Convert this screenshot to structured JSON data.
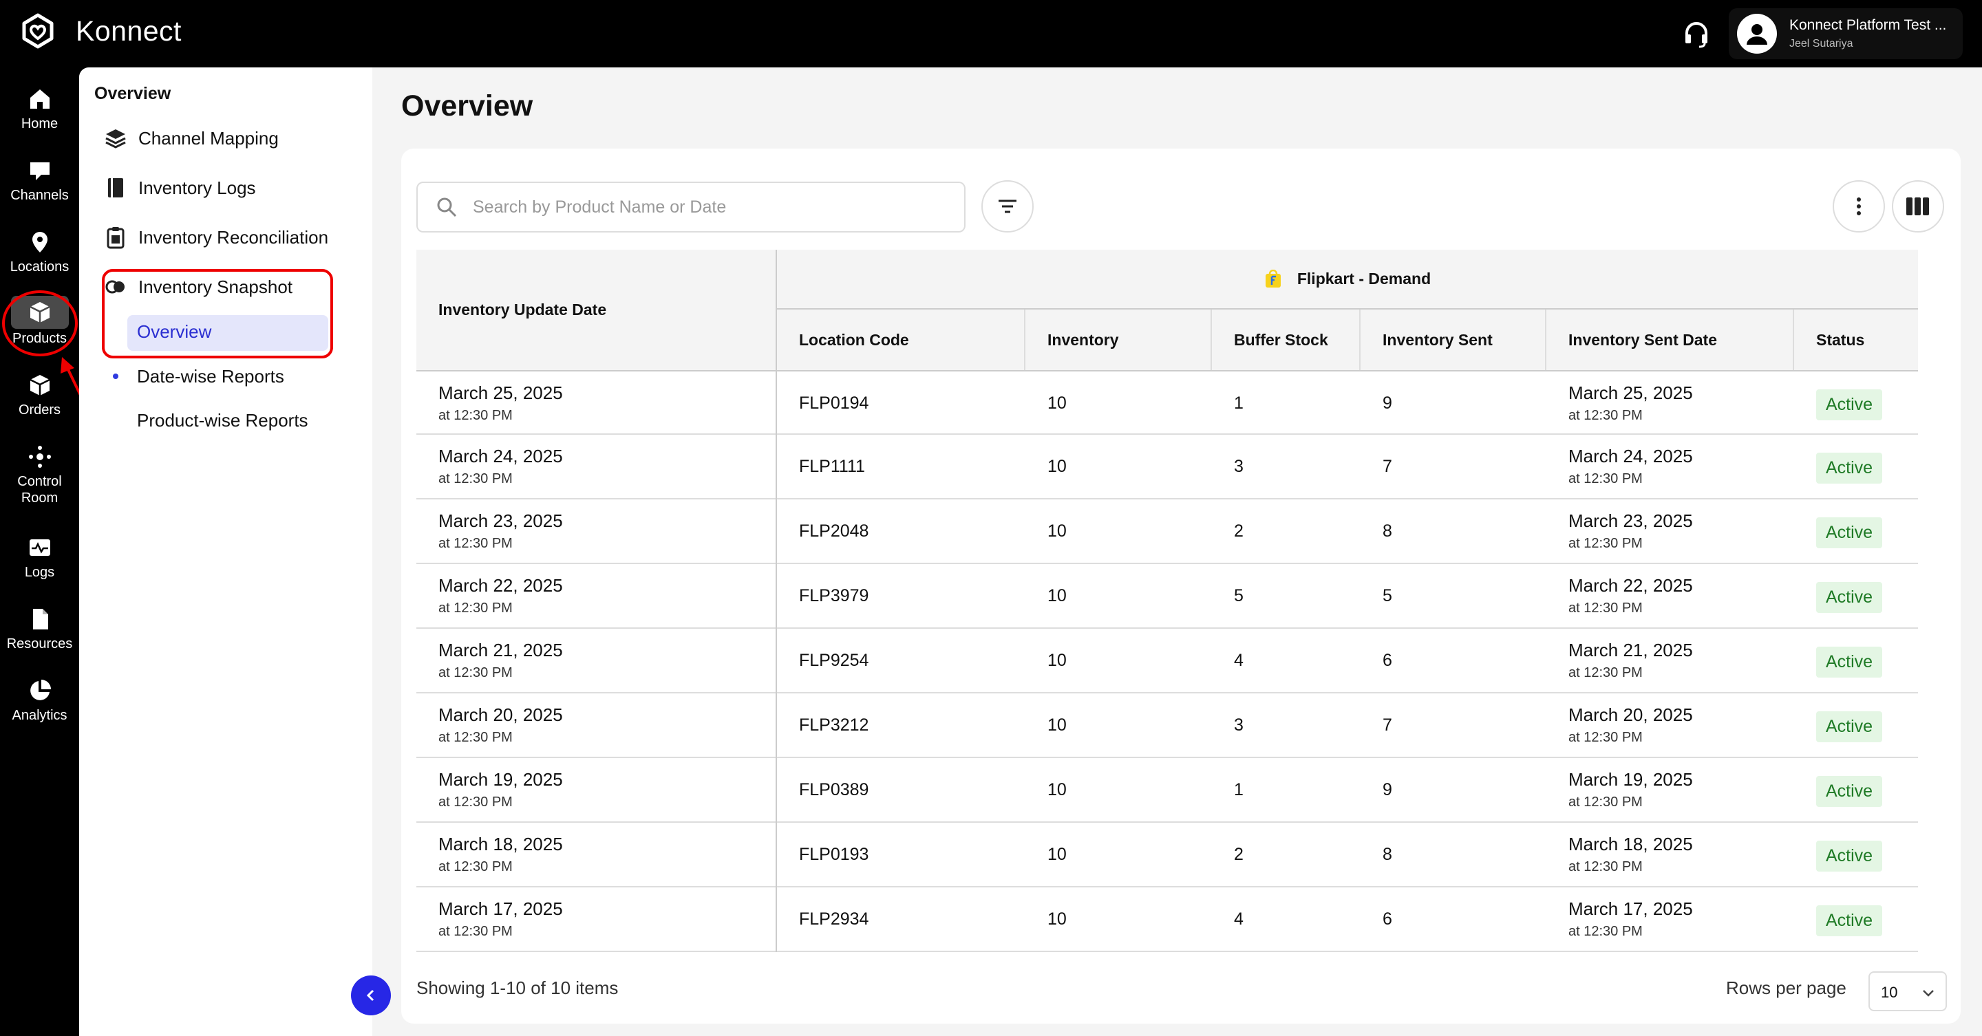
{
  "app": {
    "name": "Konnect"
  },
  "user": {
    "name": "Konnect Platform Test ...",
    "subtitle": "Jeel Sutariya"
  },
  "rail": [
    {
      "label": "Home",
      "icon": "home-icon"
    },
    {
      "label": "Channels",
      "icon": "channels-icon"
    },
    {
      "label": "Locations",
      "icon": "location-pin-icon"
    },
    {
      "label": "Products",
      "icon": "box-icon",
      "active": true
    },
    {
      "label": "Orders",
      "icon": "orders-icon"
    },
    {
      "label": "Control Room",
      "icon": "control-room-icon"
    },
    {
      "label": "Logs",
      "icon": "logs-icon"
    },
    {
      "label": "Resources",
      "icon": "file-icon"
    },
    {
      "label": "Analytics",
      "icon": "pie-chart-icon"
    }
  ],
  "subnav": {
    "title": "Overview",
    "items": [
      {
        "label": "Channel Mapping",
        "icon": "layers-icon"
      },
      {
        "label": "Inventory Logs",
        "icon": "book-icon"
      },
      {
        "label": "Inventory Reconciliation",
        "icon": "clipboard-icon"
      },
      {
        "label": "Inventory Snapshot",
        "icon": "toggle-icon"
      }
    ],
    "children": [
      {
        "label": "Overview",
        "active": true
      },
      {
        "label": "Date-wise Reports"
      },
      {
        "label": "Product-wise Reports"
      }
    ]
  },
  "main": {
    "title": "Overview",
    "search_placeholder": "Search by Product Name or Date",
    "group_header": "Flipkart - Demand",
    "columns": {
      "date": "Inventory Update Date",
      "location": "Location Code",
      "inventory": "Inventory",
      "buffer": "Buffer Stock",
      "sent": "Inventory Sent",
      "sent_date": "Inventory Sent Date",
      "status": "Status"
    },
    "rows": [
      {
        "date": "March 25, 2025",
        "time": "at 12:30 PM",
        "location": "FLP0194",
        "inventory": "10",
        "buffer": "1",
        "sent": "9",
        "sent_date": "March 25, 2025",
        "sent_time": "at 12:30 PM",
        "status": "Active"
      },
      {
        "date": "March 24, 2025",
        "time": "at 12:30 PM",
        "location": "FLP1111",
        "inventory": "10",
        "buffer": "3",
        "sent": "7",
        "sent_date": "March 24, 2025",
        "sent_time": "at 12:30 PM",
        "status": "Active"
      },
      {
        "date": "March 23, 2025",
        "time": "at 12:30 PM",
        "location": "FLP2048",
        "inventory": "10",
        "buffer": "2",
        "sent": "8",
        "sent_date": "March 23, 2025",
        "sent_time": "at 12:30 PM",
        "status": "Active"
      },
      {
        "date": "March 22, 2025",
        "time": "at 12:30 PM",
        "location": "FLP3979",
        "inventory": "10",
        "buffer": "5",
        "sent": "5",
        "sent_date": "March 22, 2025",
        "sent_time": "at 12:30 PM",
        "status": "Active"
      },
      {
        "date": "March 21, 2025",
        "time": "at 12:30 PM",
        "location": "FLP9254",
        "inventory": "10",
        "buffer": "4",
        "sent": "6",
        "sent_date": "March 21, 2025",
        "sent_time": "at 12:30 PM",
        "status": "Active"
      },
      {
        "date": "March 20, 2025",
        "time": "at 12:30 PM",
        "location": "FLP3212",
        "inventory": "10",
        "buffer": "3",
        "sent": "7",
        "sent_date": "March 20, 2025",
        "sent_time": "at 12:30 PM",
        "status": "Active"
      },
      {
        "date": "March 19, 2025",
        "time": "at 12:30 PM",
        "location": "FLP0389",
        "inventory": "10",
        "buffer": "1",
        "sent": "9",
        "sent_date": "March 19, 2025",
        "sent_time": "at 12:30 PM",
        "status": "Active"
      },
      {
        "date": "March 18, 2025",
        "time": "at 12:30 PM",
        "location": "FLP0193",
        "inventory": "10",
        "buffer": "2",
        "sent": "8",
        "sent_date": "March 18, 2025",
        "sent_time": "at 12:30 PM",
        "status": "Active"
      },
      {
        "date": "March 17, 2025",
        "time": "at 12:30 PM",
        "location": "FLP2934",
        "inventory": "10",
        "buffer": "4",
        "sent": "6",
        "sent_date": "March 17, 2025",
        "sent_time": "at 12:30 PM",
        "status": "Active"
      }
    ],
    "footer": {
      "showing": "Showing 1-10 of 10 items",
      "rows_label": "Rows per page",
      "rows_value": "10"
    }
  },
  "colors": {
    "accent": "#2727e6",
    "annotation": "#e00000",
    "status_bg": "#e4f6e4",
    "status_text": "#1e7a25"
  }
}
